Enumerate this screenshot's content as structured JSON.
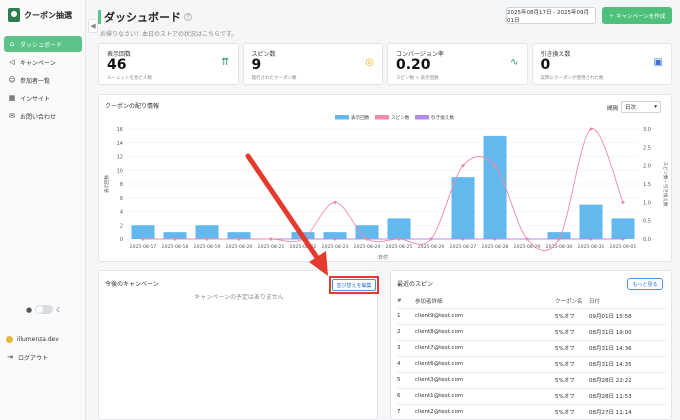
{
  "brand": {
    "name": "クーポン抽選"
  },
  "sidebar": {
    "items": [
      {
        "label": "ダッシュボード",
        "icon": "home-icon"
      },
      {
        "label": "キャンペーン",
        "icon": "megaphone-icon"
      },
      {
        "label": "参加者一覧",
        "icon": "users-icon"
      },
      {
        "label": "インサイト",
        "icon": "chart-icon"
      },
      {
        "label": "お問い合わせ",
        "icon": "mail-icon"
      }
    ],
    "footer": {
      "account": "illumenza.dev",
      "logout": "ログアウト"
    }
  },
  "header": {
    "title": "ダッシュボード",
    "subtitle": "お帰りなさい！本日のストアの状況はこちらです。",
    "date_range": "2025年08月17日 - 2025年09月01日",
    "create_label": "キャンペーンを作成"
  },
  "stats": [
    {
      "label": "表示回数",
      "value": "46",
      "desc": "ルーレットを見た人数",
      "icon": "trending-icon",
      "color": "#2e9a5e"
    },
    {
      "label": "スピン数",
      "value": "9",
      "desc": "発行されたクーポン数",
      "icon": "target-icon",
      "color": "#e5b400"
    },
    {
      "label": "コンバージョン率",
      "value": "0.20",
      "desc": "スピン数 ÷ 表示回数",
      "icon": "pulse-icon",
      "color": "#2e9a5e"
    },
    {
      "label": "引き換え数",
      "value": "0",
      "desc": "実際にクーポンが使用された数",
      "icon": "basket-icon",
      "color": "#3b6fd6"
    }
  ],
  "chart": {
    "title": "クーポンの配り情報",
    "period_label": "間隔",
    "period_value": "日次"
  },
  "chart_data": {
    "type": "bar",
    "categories": [
      "2025-08-17",
      "2025-08-18",
      "2025-08-19",
      "2025-08-20",
      "2025-08-21",
      "2025-08-22",
      "2025-08-23",
      "2025-08-24",
      "2025-08-25",
      "2025-08-26",
      "2025-08-27",
      "2025-08-28",
      "2025-08-29",
      "2025-08-30",
      "2025-08-31",
      "2025-09-01"
    ],
    "series": [
      {
        "name": "表示回数",
        "type": "bar",
        "axis": "left",
        "color": "#63b9ee",
        "values": [
          2,
          1,
          2,
          1,
          0,
          1,
          1,
          2,
          3,
          0,
          9,
          15,
          0,
          1,
          5,
          3
        ]
      },
      {
        "name": "スピン数",
        "type": "line",
        "axis": "right",
        "color": "#f08aa8",
        "values": [
          0,
          0,
          0,
          0,
          0,
          0,
          1,
          0,
          0,
          0,
          2,
          2,
          0,
          0,
          3,
          1
        ]
      },
      {
        "name": "引き換え数",
        "type": "line",
        "axis": "right",
        "color": "#b58ae8",
        "values": [
          0,
          0,
          0,
          0,
          0,
          0,
          0,
          0,
          0,
          0,
          0,
          0,
          0,
          0,
          0,
          0
        ]
      }
    ],
    "xlabel": "日付",
    "ylabel": "表示回数",
    "y2label": "スピン数・引き換え数",
    "ylim": [
      0,
      16
    ],
    "y2lim": [
      0,
      3
    ],
    "yticks": [
      "0",
      "2",
      "4",
      "6",
      "8",
      "10",
      "12",
      "14",
      "16"
    ],
    "y2ticks": [
      "0.0",
      "0.5",
      "1.0",
      "1.5",
      "2.0",
      "2.5",
      "3.0"
    ],
    "legend": "top-center",
    "grid": true
  },
  "upcoming": {
    "title": "今後のキャンペーン",
    "edit_label": "並び替えを編集",
    "empty": "キャンペーンの予定はありません"
  },
  "spins": {
    "title": "最近のスピン",
    "more_label": "もっと見る",
    "columns": [
      "#",
      "参加者詳細",
      "クーポン名",
      "日付"
    ],
    "rows": [
      [
        "1",
        "client9@test.com",
        "5%オフ",
        "09月01日 15:58"
      ],
      [
        "2",
        "client8@test.com",
        "5%オフ",
        "08月31日 19:00"
      ],
      [
        "3",
        "client7@test.com",
        "5%オフ",
        "08月31日 14:36"
      ],
      [
        "4",
        "client6@test.com",
        "5%オフ",
        "08月31日 14:35"
      ],
      [
        "5",
        "client3@test.com",
        "5%オフ",
        "08月28日 22:22"
      ],
      [
        "6",
        "client1@test.com",
        "5%オフ",
        "08月28日 11:53"
      ],
      [
        "7",
        "client2@test.com",
        "5%オフ",
        "08月27日 11:14"
      ]
    ]
  }
}
